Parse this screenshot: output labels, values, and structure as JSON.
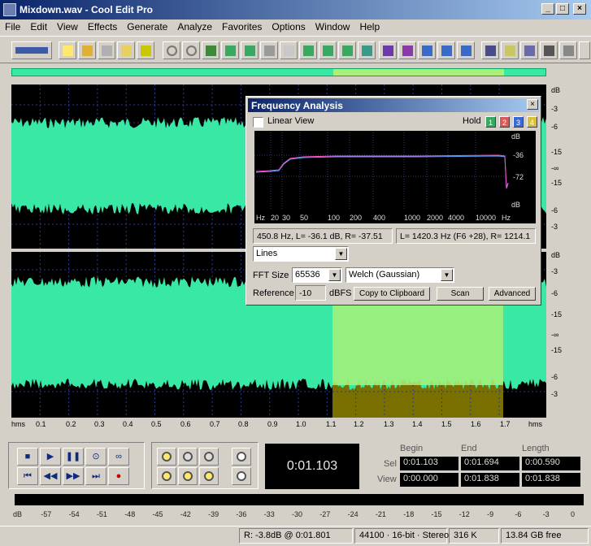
{
  "window": {
    "title": "Mixdown.wav - Cool Edit Pro"
  },
  "menu": [
    "File",
    "Edit",
    "View",
    "Effects",
    "Generate",
    "Analyze",
    "Favorites",
    "Options",
    "Window",
    "Help"
  ],
  "colors": {
    "waveform": "#38e8a4",
    "selection": "#a8f07a",
    "selection_dark": "#7a7000",
    "spectrum_line": "#ff4fd0"
  },
  "db_scale": {
    "top": [
      "dB",
      "-3",
      "-6",
      "-15",
      "-∞",
      "-15",
      "-6",
      "-3"
    ],
    "bottom": [
      "dB",
      "-3",
      "-6",
      "-15",
      "-∞",
      "-15",
      "-6",
      "-3"
    ]
  },
  "time_axis": [
    "hms",
    "0.1",
    "0.2",
    "0.3",
    "0.4",
    "0.5",
    "0.6",
    "0.7",
    "0.8",
    "0.9",
    "1.0",
    "1.1",
    "1.2",
    "1.3",
    "1.4",
    "1.5",
    "1.6",
    "1.7",
    "hms"
  ],
  "freq_analysis": {
    "title": "Frequency Analysis",
    "linear_view": "Linear View",
    "hold": "Hold",
    "hold_buttons": [
      "1",
      "2",
      "3",
      "4"
    ],
    "y_labels": [
      "dB",
      "-36",
      "-72",
      "dB"
    ],
    "x_labels": [
      "Hz",
      "20",
      "30",
      "50",
      "100",
      "200",
      "400",
      "1000",
      "2000",
      "4000",
      "10000",
      "Hz"
    ],
    "cursor_left": "450.8 Hz, L= -36.1 dB, R= -37.51",
    "cursor_right": "L= 1420.3 Hz (F6 +28), R= 1214.1",
    "display_mode": "Lines",
    "fft_size_label": "FFT Size",
    "fft_size": "65536",
    "window": "Welch (Gaussian)",
    "reference_label": "Reference",
    "reference_value": "-10",
    "reference_unit": "dBFS",
    "copy_button": "Copy to Clipboard",
    "scan_button": "Scan",
    "advanced_button": "Advanced"
  },
  "time_display": "0:01.103",
  "selection_info": {
    "col_begin": "Begin",
    "col_end": "End",
    "col_length": "Length",
    "sel_label": "Sel",
    "view_label": "View",
    "sel_begin": "0:01.103",
    "sel_end": "0:01.694",
    "sel_length": "0:00.590",
    "view_begin": "0:00.000",
    "view_end": "0:01.838",
    "view_length": "0:01.838"
  },
  "level_meter_labels": [
    "dB",
    "-57",
    "-54",
    "-51",
    "-48",
    "-45",
    "-42",
    "-39",
    "-36",
    "-33",
    "-30",
    "-27",
    "-24",
    "-21",
    "-18",
    "-15",
    "-12",
    "-9",
    "-6",
    "-3",
    "0"
  ],
  "status": {
    "cursor": "R: -3.8dB @  0:01.801",
    "format": "44100 · 16-bit · Stereo",
    "size": "316 K",
    "free": "13.84 GB free"
  }
}
